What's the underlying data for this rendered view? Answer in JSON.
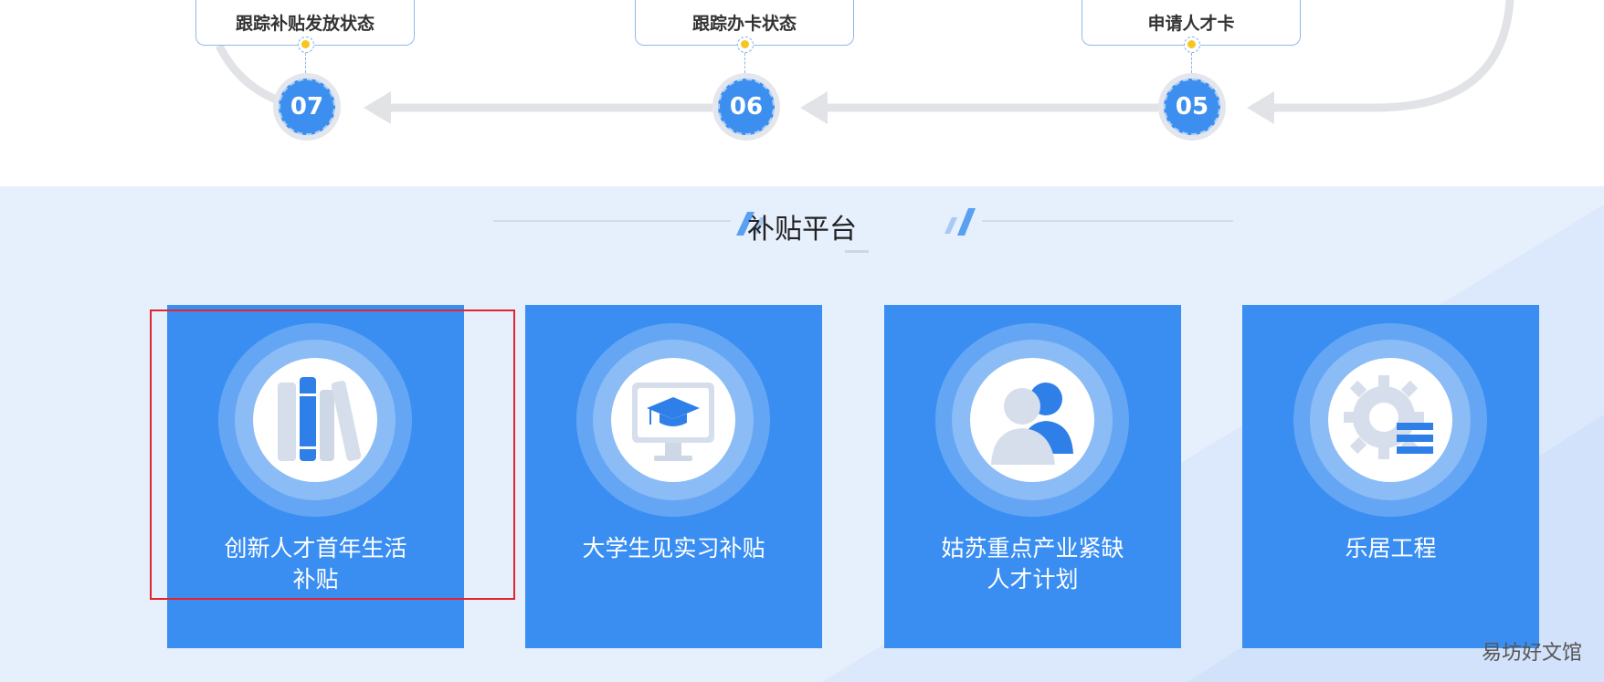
{
  "flow": {
    "steps": [
      {
        "number": "07",
        "label": "跟踪补贴发放状态"
      },
      {
        "number": "06",
        "label": "跟踪办卡状态"
      },
      {
        "number": "05",
        "label": "申请人才卡"
      }
    ]
  },
  "platform": {
    "title": "补贴平台",
    "cards": [
      {
        "line1": "创新人才首年生活",
        "line2": "补贴",
        "icon": "books-icon"
      },
      {
        "line1": "大学生见实习补贴",
        "line2": "",
        "icon": "graduation-monitor-icon"
      },
      {
        "line1": "姑苏重点产业紧缺",
        "line2": "人才计划",
        "icon": "users-icon"
      },
      {
        "line1": "乐居工程",
        "line2": "",
        "icon": "gear-list-icon"
      }
    ]
  },
  "watermark": "易坊好文馆",
  "colors": {
    "accent": "#3a8ef2",
    "highlight": "#e3242b",
    "dot": "#f7c61e"
  }
}
